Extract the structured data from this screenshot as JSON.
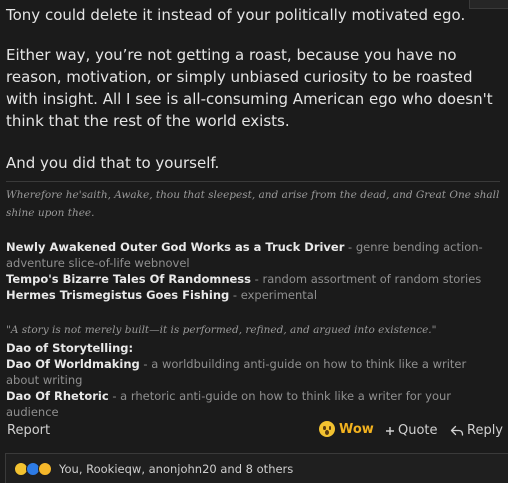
{
  "post": {
    "paragraphs": [
      "Tony could delete it instead of your politically motivated ego.",
      "Either way, you’re not getting a roast, because you have no reason, motivation, or simply unbiased curiosity to be roasted with insight. All I see is all-consuming American ego who doesn't think that the rest of the world exists.",
      "And you did that to yourself."
    ]
  },
  "signature": {
    "quote1": "Wherefore he'saith, Awake, thou that sleepest, and arise from the dead, and Great One shall shine upon thee.",
    "works": [
      {
        "title": "Newly Awakened Outer God Works as a Truck Driver",
        "desc": " - genre bending action-adventure slice-of-life webnovel"
      },
      {
        "title": "Tempo's Bizarre Tales Of Randomness",
        "desc": " - random assortment of random stories"
      },
      {
        "title": "Hermes Trismegistus Goes Fishing",
        "desc": " - experimental"
      }
    ],
    "quote2": "\"A story is not merely built—it is performed, refined, and argued into existence.\"",
    "dao_heading": "Dao of Storytelling:",
    "dao_works": [
      {
        "title": "Dao Of Worldmaking",
        "desc": " - a worldbuilding anti-guide on how to think like a writer about writing"
      },
      {
        "title": "Dao Of Rhetoric",
        "desc": " - a rhetoric anti-guide on how to think like a writer for your audience"
      }
    ]
  },
  "actions": {
    "report": "Report",
    "reaction_label": "Wow",
    "reaction_icon": "wow-emoji-icon",
    "quote": "Quote",
    "reply": "Reply"
  },
  "reactions_bar": {
    "icons": [
      "laugh-emoji-icon",
      "like-emoji-icon",
      "wow-emoji-icon"
    ],
    "summary": "You, Rookieqw, anonjohn20 and 8 others"
  },
  "colors": {
    "background": "#1b1b1b",
    "text": "#e4e4e4",
    "muted": "#8f8f8f",
    "wow": "#f2b21f"
  }
}
